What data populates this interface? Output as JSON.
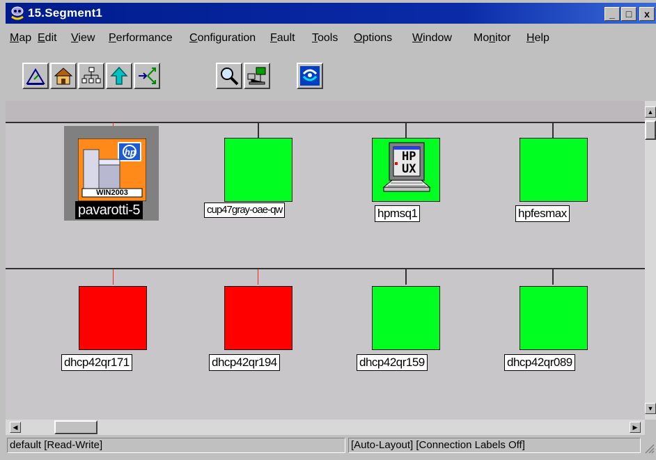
{
  "window": {
    "title": "15.Segment1",
    "controls": {
      "minimize": "_",
      "maximize": "□",
      "close": "x"
    }
  },
  "menu": [
    {
      "label": "Map",
      "accel": "M",
      "rest": "ap"
    },
    {
      "label": "Edit",
      "accel": "E",
      "rest": "dit"
    },
    {
      "label": "View",
      "accel": "V",
      "rest": "iew"
    },
    {
      "label": "Performance",
      "accel": "P",
      "rest": "erformance"
    },
    {
      "label": "Configuration",
      "accel": "C",
      "rest": "onfiguration"
    },
    {
      "label": "Fault",
      "accel": "F",
      "rest": "ault"
    },
    {
      "label": "Tools",
      "accel": "T",
      "rest": "ools"
    },
    {
      "label": "Options",
      "accel": "O",
      "rest": "ptions"
    },
    {
      "label": "Window",
      "accel": "W",
      "rest": "indow"
    },
    {
      "label": "Monitor",
      "pre": "Mo",
      "accel": "n",
      "rest": "itor"
    },
    {
      "label": "Help",
      "accel": "H",
      "rest": "elp"
    }
  ],
  "toolbar": [
    {
      "icon": "close-submap-icon"
    },
    {
      "icon": "home-map-icon"
    },
    {
      "icon": "root-map-icon"
    },
    {
      "icon": "parent-map-icon"
    },
    {
      "icon": "quick-navigator-icon"
    },
    {
      "icon": "find-icon"
    },
    {
      "icon": "network-monitor-icon"
    },
    {
      "icon": "hp-openview-icon"
    }
  ],
  "nodes_row1": [
    {
      "name": "pavarotti-5",
      "status": "selected",
      "os_label": "WIN2003",
      "brand": "hp",
      "color": "#808080"
    },
    {
      "name": "cup47gray-oae-qw",
      "status": "normal",
      "color": "#00ff20"
    },
    {
      "name": "hpmsq1",
      "status": "normal",
      "color": "#00ff20",
      "os_badge": [
        "HP",
        "UX"
      ]
    },
    {
      "name": "hpfesmax",
      "status": "normal",
      "color": "#00ff20"
    }
  ],
  "nodes_row2": [
    {
      "name": "dhcp42qr171",
      "status": "critical",
      "color": "#ff0000"
    },
    {
      "name": "dhcp42qr194",
      "status": "critical",
      "color": "#ff0000"
    },
    {
      "name": "dhcp42qr159",
      "status": "normal",
      "color": "#00ff20"
    },
    {
      "name": "dhcp42qr089",
      "status": "normal",
      "color": "#00ff20"
    }
  ],
  "status": {
    "left": "default [Read-Write]",
    "right": "[Auto-Layout] [Connection Labels Off]"
  }
}
